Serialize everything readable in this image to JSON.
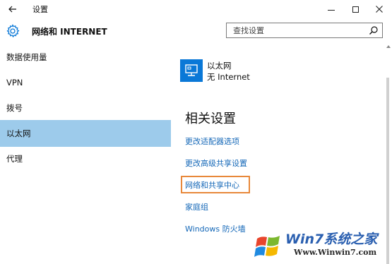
{
  "window": {
    "title": "设置"
  },
  "header": {
    "title": "网络和 INTERNET",
    "search_placeholder": "查找设置"
  },
  "sidebar": {
    "items": [
      {
        "label": "数据使用量",
        "selected": false
      },
      {
        "label": "VPN",
        "selected": false
      },
      {
        "label": "拨号",
        "selected": false
      },
      {
        "label": "以太网",
        "selected": true
      },
      {
        "label": "代理",
        "selected": false
      }
    ]
  },
  "main": {
    "connection": {
      "name": "以太网",
      "status": "无 Internet",
      "icon": "ethernet-monitor-icon"
    },
    "related_title": "相关设置",
    "links": [
      "更改适配器选项",
      "更改高级共享设置",
      "网络和共享中心",
      "家庭组",
      "Windows 防火墙"
    ]
  },
  "watermark": {
    "brand": "Win7系统之家",
    "url": "Www.Winwin7.com"
  },
  "colors": {
    "accent": "#0a78d7",
    "selected_nav": "#9dcbeb",
    "link": "#1568b8",
    "highlight": "#e8883a"
  }
}
